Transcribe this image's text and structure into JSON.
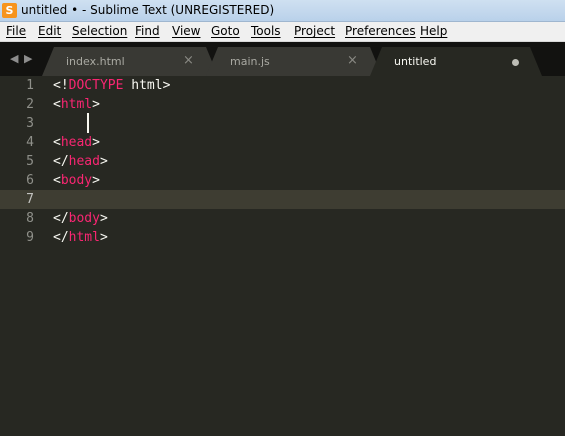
{
  "window": {
    "title": "untitled • - Sublime Text (UNREGISTERED)",
    "icon_name": "sublime-text-icon",
    "icon_glyph": "S"
  },
  "menu": [
    {
      "label": "File"
    },
    {
      "label": "Edit"
    },
    {
      "label": "Selection"
    },
    {
      "label": "Find"
    },
    {
      "label": "View"
    },
    {
      "label": "Goto"
    },
    {
      "label": "Tools"
    },
    {
      "label": "Project"
    },
    {
      "label": "Preferences"
    },
    {
      "label": "Help"
    }
  ],
  "tabs": {
    "nav_left_glyph": "◀",
    "nav_right_glyph": "▶",
    "items": [
      {
        "label": "index.html",
        "close_glyph": "×",
        "active": false
      },
      {
        "label": "main.js",
        "close_glyph": "×",
        "active": false
      },
      {
        "label": "untitled",
        "active": true,
        "dirty": true
      }
    ]
  },
  "editor": {
    "current_line": 7,
    "lines": [
      {
        "num": "1",
        "tokens": [
          {
            "t": "<!",
            "c": "punc"
          },
          {
            "t": "DOCTYPE",
            "c": "tag"
          },
          {
            "t": " html>",
            "c": "text"
          }
        ]
      },
      {
        "num": "2",
        "tokens": [
          {
            "t": "<",
            "c": "punc"
          },
          {
            "t": "html",
            "c": "tag"
          },
          {
            "t": ">",
            "c": "punc"
          }
        ]
      },
      {
        "num": "3",
        "tokens": []
      },
      {
        "num": "4",
        "tokens": [
          {
            "t": "<",
            "c": "punc"
          },
          {
            "t": "head",
            "c": "tag"
          },
          {
            "t": ">",
            "c": "punc"
          }
        ]
      },
      {
        "num": "5",
        "tokens": [
          {
            "t": "</",
            "c": "punc"
          },
          {
            "t": "head",
            "c": "tag"
          },
          {
            "t": ">",
            "c": "punc"
          }
        ]
      },
      {
        "num": "6",
        "tokens": [
          {
            "t": "<",
            "c": "punc"
          },
          {
            "t": "body",
            "c": "tag"
          },
          {
            "t": ">",
            "c": "punc"
          }
        ]
      },
      {
        "num": "7",
        "tokens": []
      },
      {
        "num": "8",
        "tokens": [
          {
            "t": "</",
            "c": "punc"
          },
          {
            "t": "body",
            "c": "tag"
          },
          {
            "t": ">",
            "c": "punc"
          }
        ]
      },
      {
        "num": "9",
        "tokens": [
          {
            "t": "</",
            "c": "punc"
          },
          {
            "t": "html",
            "c": "tag"
          },
          {
            "t": ">",
            "c": "punc"
          }
        ]
      }
    ]
  },
  "colors": {
    "editor_bg": "#272822",
    "tag": "#f92672",
    "text": "#f8f8f2",
    "line_number": "#8f908a"
  }
}
